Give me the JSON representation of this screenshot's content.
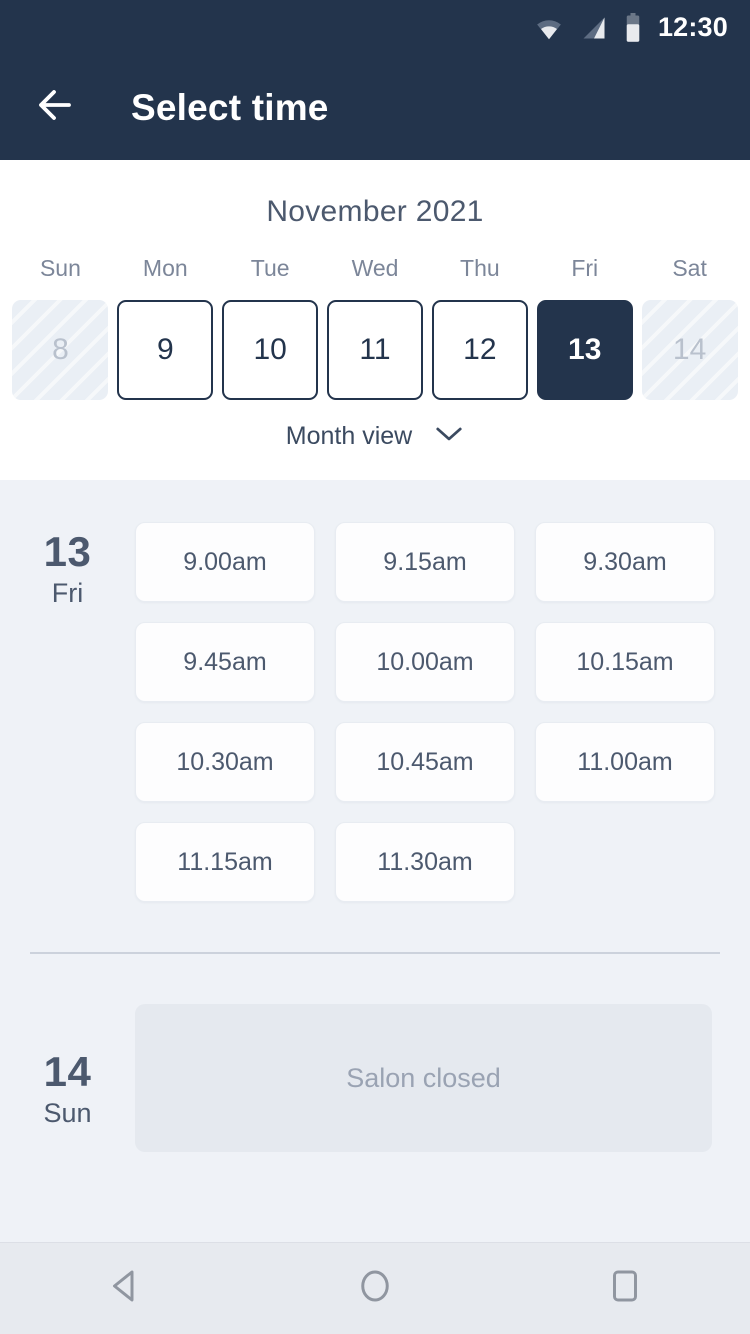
{
  "status_bar": {
    "time": "12:30",
    "icons": [
      "wifi-icon",
      "signal-icon",
      "battery-icon"
    ]
  },
  "app_bar": {
    "back_icon": "arrow-left-icon",
    "title": "Select time"
  },
  "calendar": {
    "month_label": "November 2021",
    "weekdays": [
      "Sun",
      "Mon",
      "Tue",
      "Wed",
      "Thu",
      "Fri",
      "Sat"
    ],
    "dates": [
      {
        "day": "8",
        "state": "disabled"
      },
      {
        "day": "9",
        "state": "enabled"
      },
      {
        "day": "10",
        "state": "enabled"
      },
      {
        "day": "11",
        "state": "enabled"
      },
      {
        "day": "12",
        "state": "enabled"
      },
      {
        "day": "13",
        "state": "selected"
      },
      {
        "day": "14",
        "state": "disabled"
      }
    ],
    "view_toggle": {
      "label": "Month view",
      "icon": "chevron-down-icon"
    }
  },
  "schedule": {
    "days": [
      {
        "day_number": "13",
        "day_of_week": "Fri",
        "slots": [
          "9.00am",
          "9.15am",
          "9.30am",
          "9.45am",
          "10.00am",
          "10.15am",
          "10.30am",
          "10.45am",
          "11.00am",
          "11.15am",
          "11.30am"
        ],
        "closed_message": ""
      },
      {
        "day_number": "14",
        "day_of_week": "Sun",
        "slots": [],
        "closed_message": "Salon closed"
      }
    ]
  },
  "nav_bar": {
    "back": "nav-back-icon",
    "home": "nav-home-icon",
    "recents": "nav-recents-icon"
  },
  "colors": {
    "primary_navy": "#23344c",
    "content_bg": "#eff2f7",
    "card_bg": "#fdfdfe",
    "text_muted": "#7c8699",
    "closed_card_bg": "#e5e9ef"
  }
}
